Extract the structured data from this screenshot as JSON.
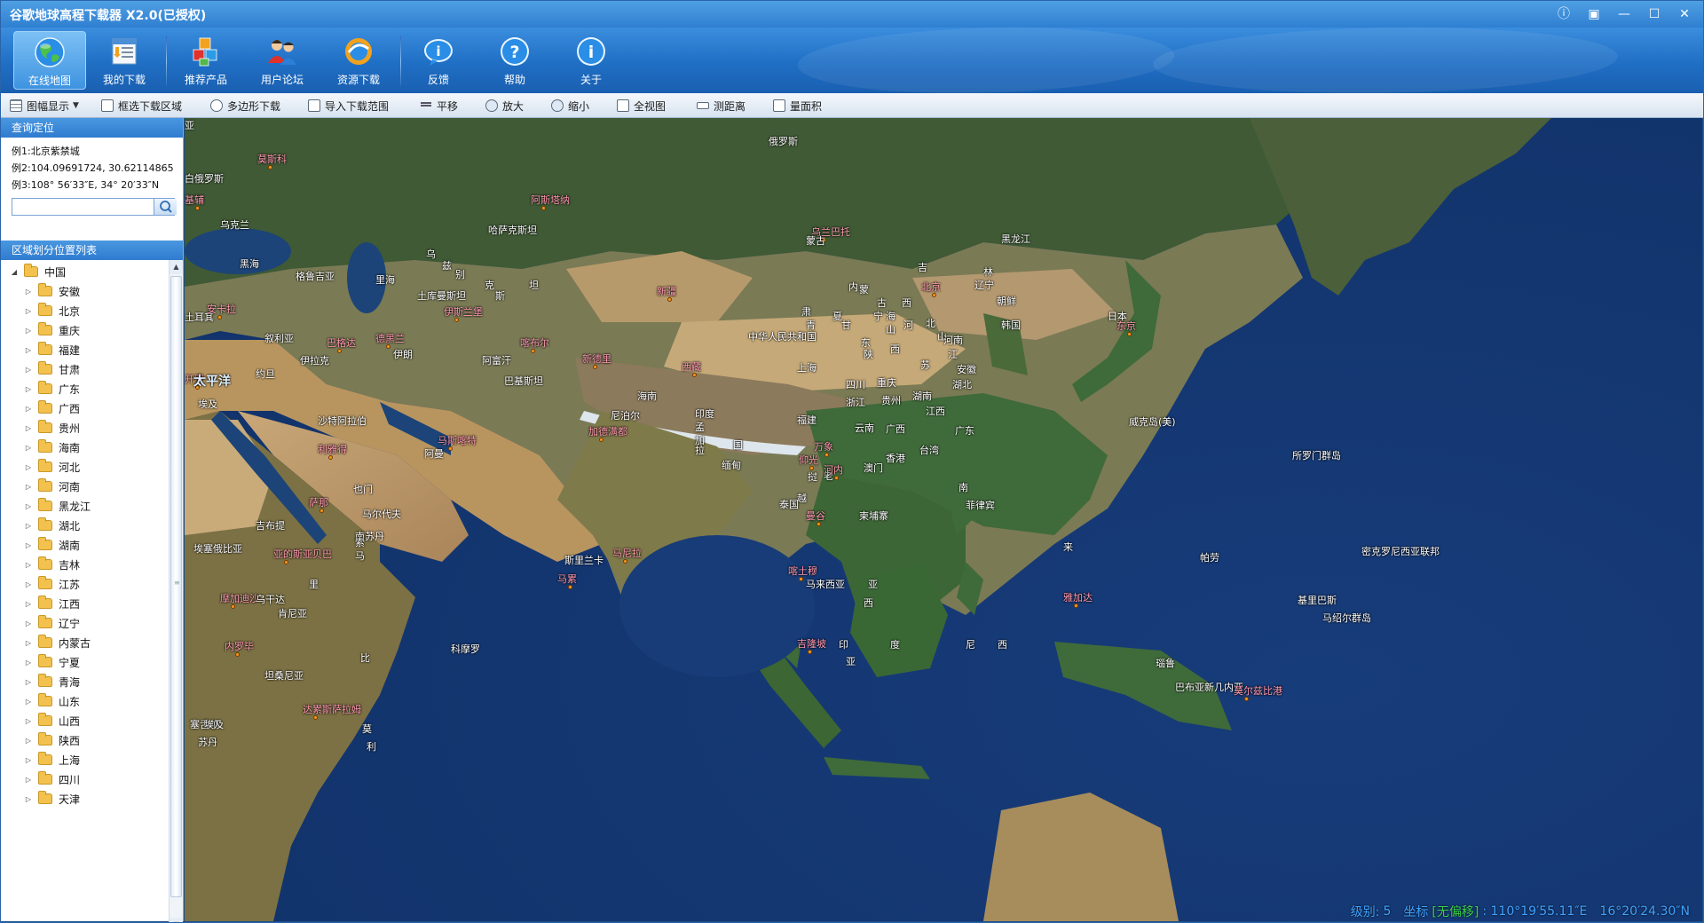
{
  "window": {
    "title": "谷歌地球高程下载器 X2.0(已授权)",
    "controls": [
      "ⓘ",
      "▣",
      "—",
      "☐",
      "✕"
    ]
  },
  "toolbar": {
    "items": [
      {
        "label": "在线地图",
        "icon": "globe-icon",
        "active": true
      },
      {
        "label": "我的下载",
        "icon": "download-list-icon"
      },
      {
        "label": "推荐产品",
        "icon": "cubes-icon"
      },
      {
        "label": "用户论坛",
        "icon": "users-icon"
      },
      {
        "label": "资源下载",
        "icon": "resource-download-icon"
      },
      {
        "label": "反馈",
        "icon": "feedback-icon"
      },
      {
        "label": "帮助",
        "icon": "help-icon"
      },
      {
        "label": "关于",
        "icon": "about-icon"
      }
    ]
  },
  "subbar": {
    "items": [
      {
        "label": "图幅显示",
        "icon": "grid-icon",
        "dropdown": true
      },
      {
        "label": "框选下载区域",
        "icon": "rect-select-icon"
      },
      {
        "label": "多边形下载",
        "icon": "polygon-icon"
      },
      {
        "label": "导入下载范围",
        "icon": "import-icon"
      },
      {
        "label": "平移",
        "icon": "pan-icon"
      },
      {
        "label": "放大",
        "icon": "zoom-in-icon"
      },
      {
        "label": "缩小",
        "icon": "zoom-out-icon"
      },
      {
        "label": "全视图",
        "icon": "full-extent-icon"
      },
      {
        "label": "测距离",
        "icon": "ruler-icon"
      },
      {
        "label": "量面积",
        "icon": "area-icon"
      }
    ]
  },
  "search": {
    "header": "查询定位",
    "examples": [
      "例1:北京紫禁城",
      "例2:104.09691724, 30.62114865",
      "例3:108° 56′33″E, 34° 20′33″N"
    ],
    "value": "",
    "placeholder": ""
  },
  "tree": {
    "header": "区域划分位置列表",
    "root": "中国",
    "items": [
      "安徽",
      "北京",
      "重庆",
      "福建",
      "甘肃",
      "广东",
      "广西",
      "贵州",
      "海南",
      "河北",
      "河南",
      "黑龙江",
      "湖北",
      "湖南",
      "吉林",
      "江苏",
      "江西",
      "辽宁",
      "内蒙古",
      "宁夏",
      "青海",
      "山东",
      "山西",
      "陕西",
      "上海",
      "四川",
      "天津"
    ]
  },
  "map": {
    "labels": [
      {
        "t": "俄罗斯",
        "c": ""
      },
      {
        "t": "莫斯科",
        "c": "pink"
      },
      {
        "t": "白俄罗斯",
        "c": ""
      },
      {
        "t": "基辅",
        "c": "pink"
      },
      {
        "t": "乌克兰",
        "c": ""
      },
      {
        "t": "哈萨克斯坦",
        "c": ""
      },
      {
        "t": "阿斯塔纳",
        "c": "pink"
      },
      {
        "t": "乌兰巴托",
        "c": "pink"
      },
      {
        "t": "蒙古",
        "c": ""
      },
      {
        "t": "黑龙江",
        "c": ""
      },
      {
        "t": "吉",
        "c": ""
      },
      {
        "t": "林",
        "c": ""
      },
      {
        "t": "辽宁",
        "c": ""
      },
      {
        "t": "朝鲜",
        "c": ""
      },
      {
        "t": "韩国",
        "c": ""
      },
      {
        "t": "日本",
        "c": ""
      },
      {
        "t": "东京",
        "c": "pink"
      },
      {
        "t": "黑海",
        "c": ""
      },
      {
        "t": "里海",
        "c": ""
      },
      {
        "t": "格鲁吉亚",
        "c": ""
      },
      {
        "t": "乌",
        "c": ""
      },
      {
        "t": "兹",
        "c": ""
      },
      {
        "t": "别",
        "c": ""
      },
      {
        "t": "克",
        "c": ""
      },
      {
        "t": "斯",
        "c": ""
      },
      {
        "t": "坦",
        "c": ""
      },
      {
        "t": "土库曼斯坦",
        "c": ""
      },
      {
        "t": "伊斯兰堡",
        "c": "pink"
      },
      {
        "t": "土耳其",
        "c": ""
      },
      {
        "t": "安卡拉",
        "c": "pink"
      },
      {
        "t": "叙利亚",
        "c": ""
      },
      {
        "t": "巴格达",
        "c": "pink"
      },
      {
        "t": "德黑兰",
        "c": "pink"
      },
      {
        "t": "伊朗",
        "c": ""
      },
      {
        "t": "伊拉克",
        "c": ""
      },
      {
        "t": "阿富汗",
        "c": ""
      },
      {
        "t": "喀布尔",
        "c": "pink"
      },
      {
        "t": "新德里",
        "c": "pink"
      },
      {
        "t": "巴基斯坦",
        "c": ""
      },
      {
        "t": "约旦",
        "c": ""
      },
      {
        "t": "开罗",
        "c": "pink"
      },
      {
        "t": "埃及",
        "c": ""
      },
      {
        "t": "沙特阿拉伯",
        "c": ""
      },
      {
        "t": "利雅得",
        "c": "pink"
      },
      {
        "t": "阿曼",
        "c": ""
      },
      {
        "t": "马斯喀特",
        "c": "pink"
      },
      {
        "t": "也门",
        "c": ""
      },
      {
        "t": "萨那",
        "c": "pink"
      },
      {
        "t": "新疆",
        "c": "pink"
      },
      {
        "t": "西藏",
        "c": "pink"
      },
      {
        "t": "中华人民共和国",
        "c": ""
      },
      {
        "t": "北京",
        "c": "pink"
      },
      {
        "t": "内",
        "c": ""
      },
      {
        "t": "蒙",
        "c": ""
      },
      {
        "t": "古",
        "c": ""
      },
      {
        "t": "宁",
        "c": ""
      },
      {
        "t": "夏",
        "c": ""
      },
      {
        "t": "甘",
        "c": ""
      },
      {
        "t": "肃",
        "c": ""
      },
      {
        "t": "青",
        "c": ""
      },
      {
        "t": "海",
        "c": ""
      },
      {
        "t": "山",
        "c": ""
      },
      {
        "t": "西",
        "c": ""
      },
      {
        "t": "河",
        "c": ""
      },
      {
        "t": "北",
        "c": ""
      },
      {
        "t": "山",
        "c": ""
      },
      {
        "t": "东",
        "c": ""
      },
      {
        "t": "陕",
        "c": ""
      },
      {
        "t": "西",
        "c": ""
      },
      {
        "t": "河南",
        "c": ""
      },
      {
        "t": "江",
        "c": ""
      },
      {
        "t": "苏",
        "c": ""
      },
      {
        "t": "安徽",
        "c": ""
      },
      {
        "t": "上海",
        "c": ""
      },
      {
        "t": "四川",
        "c": ""
      },
      {
        "t": "重庆",
        "c": ""
      },
      {
        "t": "湖北",
        "c": ""
      },
      {
        "t": "浙江",
        "c": ""
      },
      {
        "t": "贵州",
        "c": ""
      },
      {
        "t": "湖南",
        "c": ""
      },
      {
        "t": "江西",
        "c": ""
      },
      {
        "t": "福建",
        "c": ""
      },
      {
        "t": "云南",
        "c": ""
      },
      {
        "t": "广西",
        "c": ""
      },
      {
        "t": "广东",
        "c": ""
      },
      {
        "t": "台湾",
        "c": ""
      },
      {
        "t": "香港",
        "c": ""
      },
      {
        "t": "澳门",
        "c": ""
      },
      {
        "t": "海南",
        "c": ""
      },
      {
        "t": "尼泊尔",
        "c": ""
      },
      {
        "t": "加德满都",
        "c": "pink"
      },
      {
        "t": "印度",
        "c": ""
      },
      {
        "t": "孟",
        "c": ""
      },
      {
        "t": "加",
        "c": ""
      },
      {
        "t": "拉",
        "c": ""
      },
      {
        "t": "国",
        "c": ""
      },
      {
        "t": "缅甸",
        "c": ""
      },
      {
        "t": "仰光",
        "c": "pink"
      },
      {
        "t": "老",
        "c": ""
      },
      {
        "t": "挝",
        "c": ""
      },
      {
        "t": "万象",
        "c": "pink"
      },
      {
        "t": "河内",
        "c": "pink"
      },
      {
        "t": "越",
        "c": ""
      },
      {
        "t": "泰国",
        "c": ""
      },
      {
        "t": "曼谷",
        "c": "pink"
      },
      {
        "t": "柬埔寨",
        "c": ""
      },
      {
        "t": "南",
        "c": ""
      },
      {
        "t": "菲律宾",
        "c": ""
      },
      {
        "t": "马尼拉",
        "c": "pink"
      },
      {
        "t": "斯里兰卡",
        "c": ""
      },
      {
        "t": "马累",
        "c": "pink"
      },
      {
        "t": "马尔代夫",
        "c": ""
      },
      {
        "t": "吉布提",
        "c": ""
      },
      {
        "t": "亚的斯亚贝巴",
        "c": "pink"
      },
      {
        "t": "埃塞俄比亚",
        "c": ""
      },
      {
        "t": "南苏丹",
        "c": ""
      },
      {
        "t": "索",
        "c": ""
      },
      {
        "t": "马",
        "c": ""
      },
      {
        "t": "里",
        "c": ""
      },
      {
        "t": "摩加迪沙",
        "c": "pink"
      },
      {
        "t": "乌干达",
        "c": ""
      },
      {
        "t": "肯尼亚",
        "c": ""
      },
      {
        "t": "内罗毕",
        "c": "pink"
      },
      {
        "t": "坦桑尼亚",
        "c": ""
      },
      {
        "t": "达累斯萨拉姆",
        "c": "pink"
      },
      {
        "t": "科摩罗",
        "c": ""
      },
      {
        "t": "塞舌尔",
        "c": ""
      },
      {
        "t": "苏丹",
        "c": ""
      },
      {
        "t": "喀土穆",
        "c": "pink"
      },
      {
        "t": "马来西亚",
        "c": ""
      },
      {
        "t": "吉隆坡",
        "c": "pink"
      },
      {
        "t": "印",
        "c": ""
      },
      {
        "t": "度",
        "c": ""
      },
      {
        "t": "尼",
        "c": ""
      },
      {
        "t": "西",
        "c": ""
      },
      {
        "t": "亚",
        "c": ""
      },
      {
        "t": "雅加达",
        "c": "pink"
      },
      {
        "t": "亚",
        "c": ""
      },
      {
        "t": "西",
        "c": ""
      },
      {
        "t": "来",
        "c": ""
      },
      {
        "t": "帕劳",
        "c": ""
      },
      {
        "t": "密克罗尼西亚联邦",
        "c": ""
      },
      {
        "t": "马绍尔群岛",
        "c": ""
      },
      {
        "t": "基里巴斯",
        "c": ""
      },
      {
        "t": "瑙鲁",
        "c": ""
      },
      {
        "t": "巴布亚新几内亚",
        "c": ""
      },
      {
        "t": "莫尔兹比港",
        "c": "pink"
      },
      {
        "t": "所罗门群岛",
        "c": ""
      },
      {
        "t": "威克岛(美)",
        "c": ""
      },
      {
        "t": "太平洋",
        "c": "big"
      },
      {
        "t": "埃及",
        "c": ""
      },
      {
        "t": "比",
        "c": ""
      },
      {
        "t": "莫",
        "c": ""
      },
      {
        "t": "利",
        "c": ""
      },
      {
        "t": "亚",
        "c": ""
      }
    ]
  },
  "status": {
    "level_label": "级别:",
    "level": "5",
    "coord_label": "坐标",
    "offset_label": "[无偏移]",
    "lon": ": 110°19′55.11″E",
    "lat": "16°20′24.30″N"
  }
}
